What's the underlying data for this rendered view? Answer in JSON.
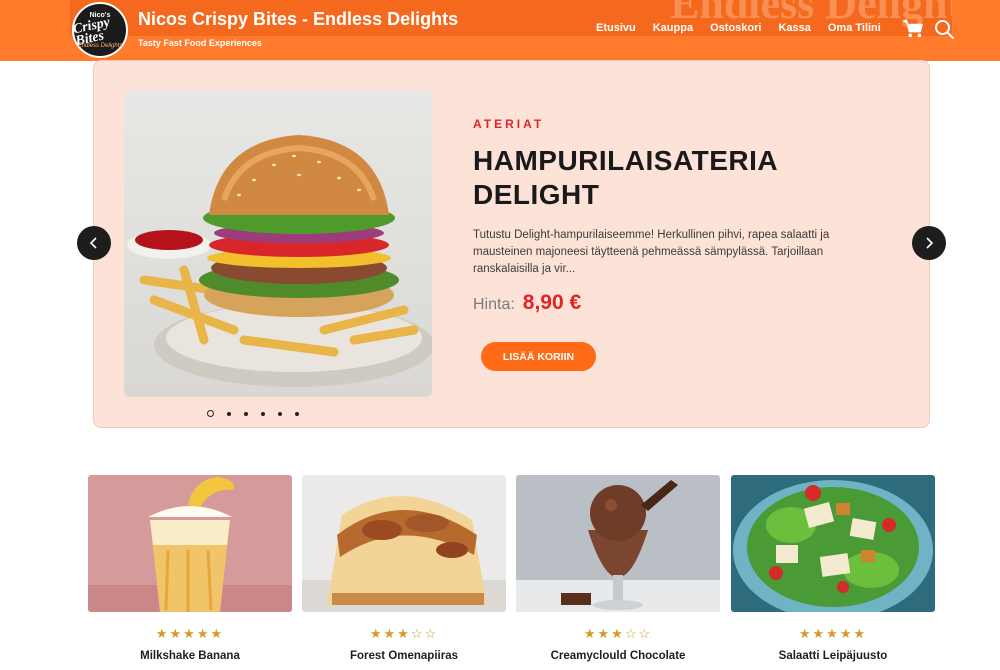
{
  "header": {
    "logo_text": [
      "Nico's",
      "Crispy Bites",
      "Endless Delights"
    ],
    "title": "Nicos Crispy Bites - Endless Delights",
    "tagline": "Tasty Fast Food Experiences",
    "nav": [
      "Etusivu",
      "Kauppa",
      "Ostoskori",
      "Kassa",
      "Oma Tilini"
    ],
    "icons": [
      "cart-icon",
      "search-icon"
    ],
    "brand_color": "#ff7a2b"
  },
  "slider": {
    "category": "ATERIAT",
    "title": "HAMPURILAISATERIA DELIGHT",
    "description": "Tutustu Delight-hampurilaiseemme! Herkullinen pihvi, rapea salaatti ja mausteinen majoneesi täytteenä pehmeässä sämpylässä. Tarjoillaan ranskalaisilla ja vir...",
    "price_label": "Hinta:",
    "price": "8,90 €",
    "button": "LISÄÄ KORIIN",
    "slide_count": 6,
    "active_slide": 1,
    "accent_color": "#ff6a16",
    "price_color": "#e02424"
  },
  "products": [
    {
      "name": "Milkshake Banana",
      "stars": "★★★★★",
      "rating": 5
    },
    {
      "name": "Forest Omenapiiras",
      "stars": "★★★☆☆",
      "rating": 3
    },
    {
      "name": "Creamyclould Chocolate",
      "stars": "★★★☆☆",
      "rating": 3
    },
    {
      "name": "Salaatti Leipäjuusto",
      "stars": "★★★★★",
      "rating": 5
    }
  ]
}
